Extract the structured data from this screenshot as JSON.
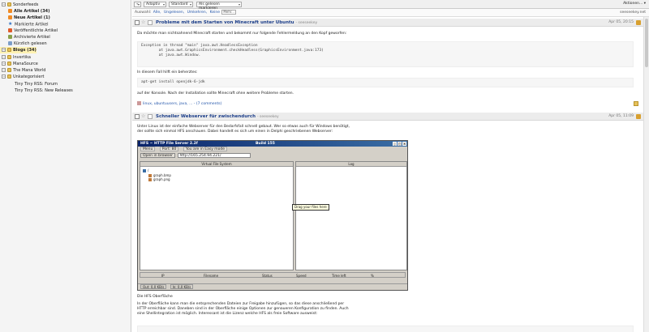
{
  "sidebar": {
    "items": [
      {
        "label": "Sonderfeeds",
        "level": 0,
        "type": "folder",
        "bold": false
      },
      {
        "label": "Alle Artikel (34)",
        "level": 1,
        "type": "rss",
        "bold": true
      },
      {
        "label": "Neue Artikel (1)",
        "level": 1,
        "type": "rss",
        "bold": true
      },
      {
        "label": "Markierte Artikel",
        "level": 1,
        "type": "star",
        "bold": false
      },
      {
        "label": "Veröffentlichte Artikel",
        "level": 1,
        "type": "pub",
        "bold": false
      },
      {
        "label": "Archivierte Artikel",
        "level": 1,
        "type": "archive",
        "bold": false
      },
      {
        "label": "Kürzlich gelesen",
        "level": 1,
        "type": "clock",
        "bold": false
      },
      {
        "label": "Blogs (34)",
        "level": 0,
        "type": "folder",
        "bold": true,
        "highlight": true
      },
      {
        "label": "Invertika",
        "level": 0,
        "type": "folder",
        "bold": false
      },
      {
        "label": "ManaSource",
        "level": 0,
        "type": "folder",
        "bold": false
      },
      {
        "label": "The Mana World",
        "level": 0,
        "type": "folder",
        "bold": false
      },
      {
        "label": "Unkategorisiert",
        "level": 0,
        "type": "folder",
        "bold": false
      },
      {
        "label": "Tiny Tiny RSS: Forum",
        "level": 2,
        "type": "none",
        "bold": false
      },
      {
        "label": "Tiny Tiny RSS: New Releases",
        "level": 2,
        "type": "none",
        "bold": false
      }
    ]
  },
  "toolbar": {
    "view_mode": "Adaptiv",
    "order": "Standard",
    "mark_read": "Als gelesen markieren",
    "actions": "Aktionen..."
  },
  "filterbar": {
    "label": "Auswahl:",
    "links": [
      "Alle,",
      "Ungelesen,",
      "Umkehren,",
      "Keine"
    ],
    "more_select": "Mehr...",
    "feed_title": "seeseekey.net"
  },
  "articles": [
    {
      "title": "Probleme mit dem Starten von Minecraft unter Ubuntu",
      "author": "- seeseekey",
      "date": "Apr 05, 20:15",
      "intro": "Da möchte man nichtsahnend Minecraft starten und bekommt nur folgende Fehlermeldung an den Kopf geworfen:",
      "code1": "Exception in thread \"main\" java.awt.HeadlessException\n        at java.awt.GraphicsEnvironment.checkHeadless(GraphicsEnvironment.java:173)\n        at java.awt.Window.",
      "line2": "In diesem Fall hilft ein beherztes:",
      "code2": "apt-get install openjdk-6-jdk",
      "line3": "auf der Konsole. Nach der Installation sollte Minecraft ohne weitere Probleme starten.",
      "footer": "linux, ubuntuusers, java, ... - (7 comments)"
    },
    {
      "title": "Schneller Webserver für zwischendurch",
      "author": "- seeseekey",
      "date": "Apr 05, 11:09",
      "intro1": "Unter Linux ist der einfache Webserver für den Bedarfsfall schnell gebaut. Wer so etwas auch für Windows benötigt,",
      "intro2": "der sollte sich einmal HFS anschauen. Dabei handelt es sich um einen in Delphi geschriebenen Webserver:",
      "caption": "Die HFS Oberfläche",
      "para1": "In der Oberfläche kann man die entsprechenden Dateien zur Freigabe hinzufügen, so das diese anschließend per",
      "para2": "HTTP erreichbar sind. Daneben sind in der Oberfläche einige Optionen zur genaueren Konfiguration zu finden. Auch",
      "para3": "eine Shellintegration ist möglich. Interessant ist die Lizenz welche HFS als freie Software ausweist:"
    }
  ],
  "hfs": {
    "title": "HFS ~ HTTP File Server 2.2f",
    "build": "Build 155",
    "menu": "Menu",
    "port": "Port: 80",
    "mode": "You are in Easy mode",
    "open_browser": "Open in browser",
    "url": "http://165.254.94.221/",
    "vfs_header": "Virtual File System",
    "log_header": "Log",
    "root": "/",
    "files": [
      "graph.bmp",
      "graph.png"
    ],
    "drag_hint": "Drag your files here",
    "conn_cols": [
      "IP",
      "Filename",
      "Status",
      "Speed",
      "Time left",
      "%"
    ],
    "status_out": "Out: 0,0 KB/s",
    "status_in": "In: 0,0 KB/s"
  }
}
